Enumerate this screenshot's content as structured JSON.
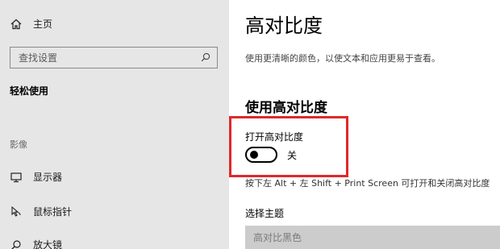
{
  "sidebar": {
    "home_label": "主页",
    "home_icon": "home-icon",
    "search_placeholder": "查找设置",
    "search_icon": "search-icon",
    "section_title": "轻松使用",
    "group_label": "影像",
    "items": [
      {
        "label": "显示器",
        "icon": "monitor-icon"
      },
      {
        "label": "鼠标指针",
        "icon": "mouse-pointer-icon"
      },
      {
        "label": "放大镜",
        "icon": "magnifier-icon"
      }
    ]
  },
  "main": {
    "title": "高对比度",
    "description": "使用更清晰的颜色，以使文本和应用更易于查看。",
    "subtitle": "使用高对比度",
    "toggle_label": "打开高对比度",
    "toggle_state": "关",
    "toggle_on": false,
    "shortcut_hint": "按下左 Alt + 左 Shift + Print Screen 可打开和关闭高对比度",
    "theme_label": "选择主题",
    "theme_value": "高对比黑色"
  },
  "colors": {
    "sidebar_bg": "#e6e6e6",
    "highlight_border": "#e0282a",
    "select_bg": "#cccccc"
  }
}
